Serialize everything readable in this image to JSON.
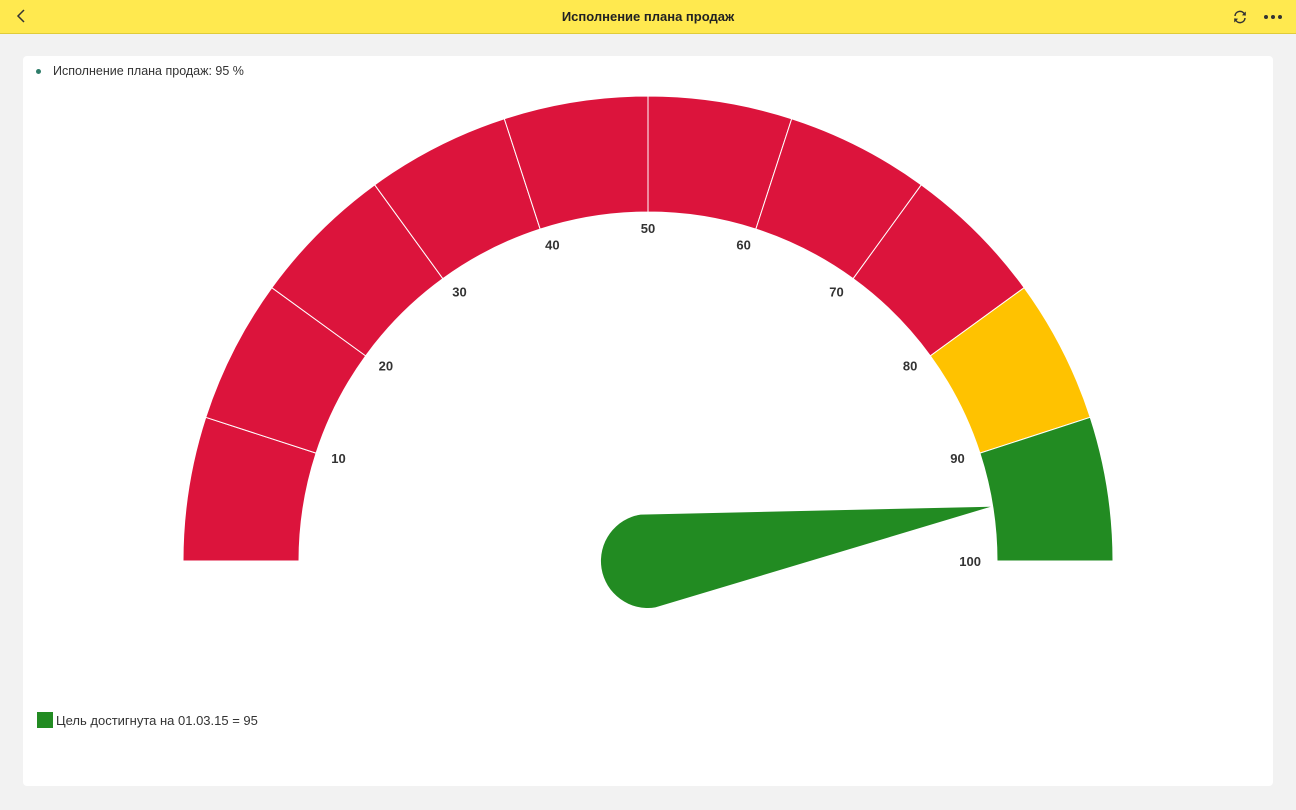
{
  "header": {
    "title": "Исполнение плана продаж",
    "back_icon": "chevron-left-icon",
    "refresh_icon": "refresh-icon",
    "more_icon": "more-dots-icon"
  },
  "legend": {
    "series_label": "Исполнение плана продаж: 95 %",
    "goal_label": "Цель достигнута на 01.03.15 = 95"
  },
  "colors": {
    "header_bg": "#ffe94f",
    "danger": "#dc143c",
    "warning": "#ffc200",
    "success": "#228b22",
    "series_dot": "#2f7d6a"
  },
  "chart_data": {
    "type": "gauge",
    "min": 0,
    "max": 100,
    "value": 95,
    "ticks": [
      10,
      20,
      30,
      40,
      50,
      60,
      70,
      80,
      90,
      100
    ],
    "bands": [
      {
        "from": 0,
        "to": 10,
        "color": "#dc143c"
      },
      {
        "from": 10,
        "to": 20,
        "color": "#dc143c"
      },
      {
        "from": 20,
        "to": 30,
        "color": "#dc143c"
      },
      {
        "from": 30,
        "to": 40,
        "color": "#dc143c"
      },
      {
        "from": 40,
        "to": 50,
        "color": "#dc143c"
      },
      {
        "from": 50,
        "to": 60,
        "color": "#dc143c"
      },
      {
        "from": 60,
        "to": 70,
        "color": "#dc143c"
      },
      {
        "from": 70,
        "to": 80,
        "color": "#dc143c"
      },
      {
        "from": 80,
        "to": 90,
        "color": "#ffc200"
      },
      {
        "from": 90,
        "to": 100,
        "color": "#228b22"
      }
    ],
    "needle_color": "#228b22"
  }
}
